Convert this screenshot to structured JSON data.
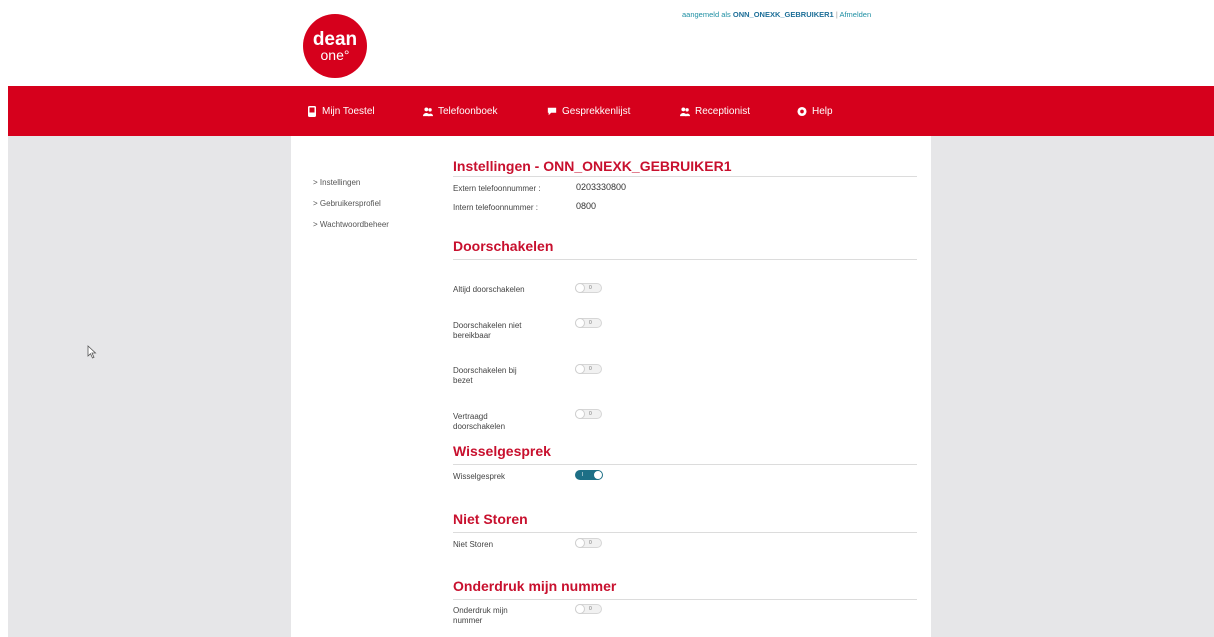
{
  "logo": {
    "line1": "dean",
    "line2": "one°"
  },
  "userbar": {
    "prefix": "aangemeld als ",
    "username": "ONN_ONEXK_GEBRUIKER1",
    "separator": " | ",
    "logout": "Afmelden"
  },
  "nav": [
    {
      "label": "Mijn Toestel",
      "icon": "phone-icon"
    },
    {
      "label": "Telefoonboek",
      "icon": "contacts-icon"
    },
    {
      "label": "Gesprekkenlijst",
      "icon": "chat-bubble-icon"
    },
    {
      "label": "Receptionist",
      "icon": "receptionist-icon"
    },
    {
      "label": "Help",
      "icon": "help-lifebuoy-icon"
    }
  ],
  "sidebar": [
    "> Instellingen",
    "> Gebruikersprofiel",
    "> Wachtwoordbeheer"
  ],
  "settings": {
    "title": "Instellingen - ONN_ONEXK_GEBRUIKER1",
    "extern_label": "Extern telefoonnummer :",
    "extern_value": "0203330800",
    "intern_label": "Intern telefoonnummer :",
    "intern_value": "0800"
  },
  "doorschakelen": {
    "title": "Doorschakelen",
    "items": [
      {
        "label": "Altijd doorschakelen",
        "state": "0"
      },
      {
        "label": "Doorschakelen niet bereikbaar",
        "state": "0"
      },
      {
        "label": "Doorschakelen bij bezet",
        "state": "0"
      },
      {
        "label": "Vertraagd doorschakelen",
        "state": "0"
      }
    ]
  },
  "wisselgesprek": {
    "title": "Wisselgesprek",
    "label": "Wisselgesprek",
    "state": "I"
  },
  "niet_storen": {
    "title": "Niet Storen",
    "label": "Niet Storen",
    "state": "0"
  },
  "onderdruk": {
    "title": "Onderdruk mijn nummer",
    "label": "Onderdruk mijn nummer",
    "state": "0"
  },
  "colors": {
    "brand_red": "#d6001c",
    "title_red": "#c8102e",
    "link_blue": "#1e8fa3",
    "toggle_on": "#1d6f86"
  }
}
